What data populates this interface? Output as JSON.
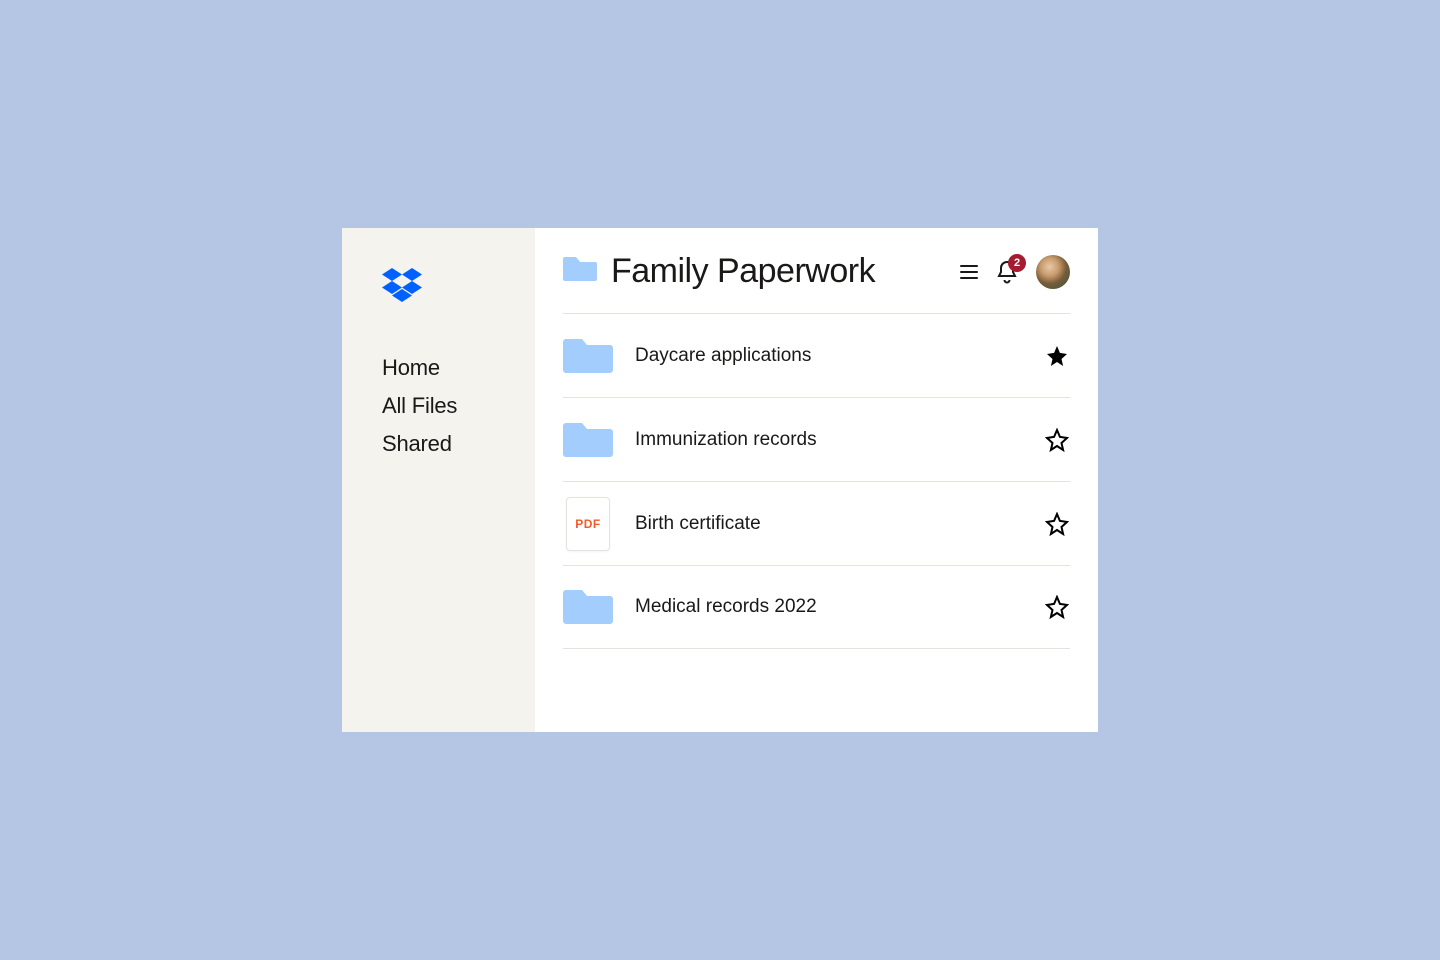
{
  "sidebar": {
    "items": [
      {
        "label": "Home"
      },
      {
        "label": "All Files"
      },
      {
        "label": "Shared"
      }
    ]
  },
  "header": {
    "title": "Family Paperwork",
    "notifications": "2"
  },
  "files": [
    {
      "name": "Daycare applications",
      "type": "folder",
      "starred": true,
      "pdf_label": ""
    },
    {
      "name": "Immunization records",
      "type": "folder",
      "starred": false,
      "pdf_label": ""
    },
    {
      "name": "Birth certificate",
      "type": "pdf",
      "starred": false,
      "pdf_label": "PDF"
    },
    {
      "name": "Medical records 2022",
      "type": "folder",
      "starred": false,
      "pdf_label": ""
    }
  ],
  "colors": {
    "folder": "#a3cdfc",
    "accent_blue": "#0061fe",
    "badge": "#a51c30"
  }
}
